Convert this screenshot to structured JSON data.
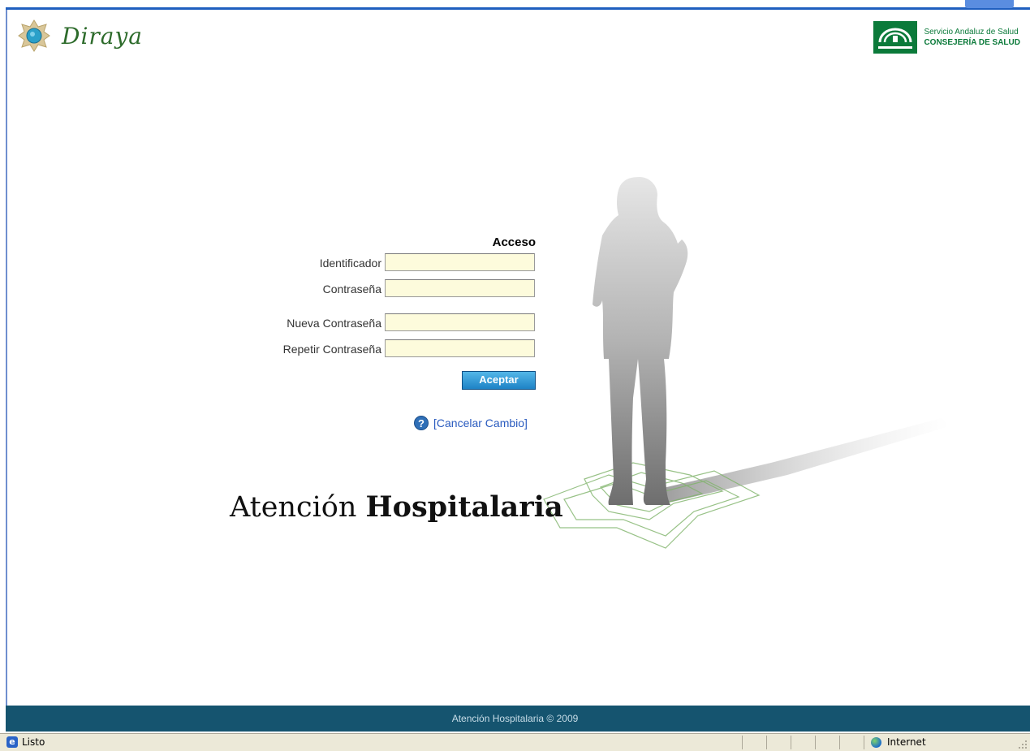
{
  "header": {
    "brand_name": "Diraya",
    "agency_line1": "Servicio Andaluz de Salud",
    "agency_line2": "CONSEJERÍA DE SALUD"
  },
  "login": {
    "title": "Acceso",
    "fields": [
      {
        "label": "Identificador",
        "value": ""
      },
      {
        "label": "Contraseña",
        "value": ""
      },
      {
        "label": "Nueva Contraseña",
        "value": ""
      },
      {
        "label": "Repetir Contraseña",
        "value": ""
      }
    ],
    "accept_label": "Aceptar",
    "cancel_label": "[Cancelar Cambio]"
  },
  "hero": {
    "headline_regular": "Atención",
    "headline_bold": "Hospitalaria"
  },
  "footer": {
    "text": "Atención Hospitalaria © 2009"
  },
  "statusbar": {
    "status": "Listo",
    "zone": "Internet"
  },
  "colors": {
    "footer_bg": "#15546f",
    "field_bg": "#fdfbdc",
    "button_blue": "#1e83c6",
    "agency_green": "#0b7a3a"
  }
}
